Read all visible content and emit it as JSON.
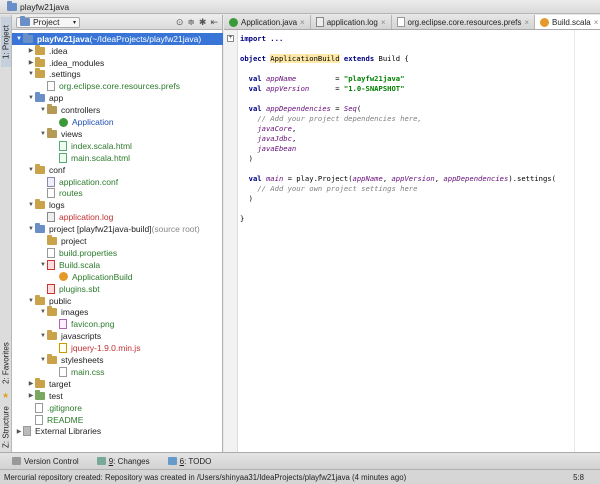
{
  "navbar": {
    "crumb": "playfw21java"
  },
  "left_tabs": {
    "project": "1: Project",
    "favorites": "2: Favorites",
    "structure": "Z: Structure"
  },
  "project_panel": {
    "selector": "Project"
  },
  "tree": [
    {
      "depth": 0,
      "arrow": "▼",
      "icon": "folder-blue",
      "label": "playfw21java",
      "extra": " (~/IdeaProjects/playfw21java)",
      "cls": "",
      "selected": true
    },
    {
      "depth": 1,
      "arrow": "▶",
      "icon": "folder",
      "label": ".idea",
      "cls": ""
    },
    {
      "depth": 1,
      "arrow": "▶",
      "icon": "folder",
      "label": ".idea_modules",
      "cls": ""
    },
    {
      "depth": 1,
      "arrow": "▼",
      "icon": "folder",
      "label": ".settings",
      "cls": ""
    },
    {
      "depth": 2,
      "arrow": "",
      "icon": "file",
      "label": "org.eclipse.core.resources.prefs",
      "cls": "t-green"
    },
    {
      "depth": 1,
      "arrow": "▼",
      "icon": "folder-blue",
      "label": "app",
      "cls": ""
    },
    {
      "depth": 2,
      "arrow": "▼",
      "icon": "folder-pkg",
      "label": "controllers",
      "cls": ""
    },
    {
      "depth": 3,
      "arrow": "",
      "icon": "class",
      "label": "Application",
      "cls": "t-blue"
    },
    {
      "depth": 2,
      "arrow": "▼",
      "icon": "folder-pkg",
      "label": "views",
      "cls": ""
    },
    {
      "depth": 3,
      "arrow": "",
      "icon": "html",
      "label": "index.scala.html",
      "cls": "t-green"
    },
    {
      "depth": 3,
      "arrow": "",
      "icon": "html",
      "label": "main.scala.html",
      "cls": "t-green"
    },
    {
      "depth": 1,
      "arrow": "▼",
      "icon": "folder",
      "label": "conf",
      "cls": ""
    },
    {
      "depth": 2,
      "arrow": "",
      "icon": "conf",
      "label": "application.conf",
      "cls": "t-green"
    },
    {
      "depth": 2,
      "arrow": "",
      "icon": "file",
      "label": "routes",
      "cls": "t-green"
    },
    {
      "depth": 1,
      "arrow": "▼",
      "icon": "folder",
      "label": "logs",
      "cls": ""
    },
    {
      "depth": 2,
      "arrow": "",
      "icon": "log",
      "label": "application.log",
      "cls": "t-red"
    },
    {
      "depth": 1,
      "arrow": "▼",
      "icon": "folder-blue",
      "label": "project [playfw21java-build]",
      "extra": " (source root)",
      "cls": ""
    },
    {
      "depth": 2,
      "arrow": "",
      "icon": "folder",
      "label": "project",
      "cls": ""
    },
    {
      "depth": 2,
      "arrow": "",
      "icon": "file",
      "label": "build.properties",
      "cls": "t-green"
    },
    {
      "depth": 2,
      "arrow": "▼",
      "icon": "scala",
      "label": "Build.scala",
      "cls": "t-green"
    },
    {
      "depth": 3,
      "arrow": "",
      "icon": "object",
      "label": "ApplicationBuild",
      "cls": "t-green"
    },
    {
      "depth": 2,
      "arrow": "",
      "icon": "scala",
      "label": "plugins.sbt",
      "cls": "t-green"
    },
    {
      "depth": 1,
      "arrow": "▼",
      "icon": "folder",
      "label": "public",
      "cls": ""
    },
    {
      "depth": 2,
      "arrow": "▼",
      "icon": "folder",
      "label": "images",
      "cls": ""
    },
    {
      "depth": 3,
      "arrow": "",
      "icon": "img",
      "label": "favicon.png",
      "cls": "t-green"
    },
    {
      "depth": 2,
      "arrow": "▼",
      "icon": "folder",
      "label": "javascripts",
      "cls": ""
    },
    {
      "depth": 3,
      "arrow": "",
      "icon": "js",
      "label": "jquery-1.9.0.min.js",
      "cls": "t-red"
    },
    {
      "depth": 2,
      "arrow": "▼",
      "icon": "folder",
      "label": "stylesheets",
      "cls": ""
    },
    {
      "depth": 3,
      "arrow": "",
      "icon": "file",
      "label": "main.css",
      "cls": "t-green"
    },
    {
      "depth": 1,
      "arrow": "▶",
      "icon": "folder",
      "label": "target",
      "cls": ""
    },
    {
      "depth": 1,
      "arrow": "▶",
      "icon": "folder-green",
      "label": "test",
      "cls": ""
    },
    {
      "depth": 1,
      "arrow": "",
      "icon": "file",
      "label": ".gitignore",
      "cls": "t-green"
    },
    {
      "depth": 1,
      "arrow": "",
      "icon": "file",
      "label": "README",
      "cls": "t-green"
    },
    {
      "depth": 0,
      "arrow": "▶",
      "icon": "lib",
      "label": "External Libraries",
      "cls": ""
    }
  ],
  "tabs": [
    {
      "label": "Application.java",
      "icon": "class",
      "active": false
    },
    {
      "label": "application.log",
      "icon": "log",
      "active": false
    },
    {
      "label": "org.eclipse.core.resources.prefs",
      "icon": "file",
      "active": false
    },
    {
      "label": "Build.scala",
      "icon": "object",
      "active": true
    }
  ],
  "code": {
    "import": "import ...",
    "obj_kw": "object ",
    "obj_name": "ApplicationBuild",
    "extends_kw": " extends ",
    "extends_name": "Build {",
    "val1": "appName",
    "val1_pad": "         = ",
    "str1": "\"playfw21java\"",
    "val2": "appVersion",
    "val2_pad": "      = ",
    "str2": "\"1.0-SNAPSHOT\"",
    "val3": "appDependencies",
    "val3_rest": " = ",
    "seq": "Seq",
    "seq_open": "(",
    "cmt1": "// Add your project dependencies here,",
    "dep1": "javaCore",
    "dep2": "javaJdbc",
    "dep3": "javaEbean",
    "close_paren": ")",
    "val4": "main",
    "main_rest1": " = play.Project(",
    "main_args_a": "appName",
    "main_args_b": "appVersion",
    "main_args_c": "appDependencies",
    "main_rest2": ").settings(",
    "cmt2": "// Add your own project settings here",
    "close_brace": "}"
  },
  "bottom_tools": {
    "vc": "Version Control",
    "changes_num": "9",
    "changes": ": Changes",
    "todo_num": "6",
    "todo": ": TODO"
  },
  "status": {
    "message": "Mercurial repository created: Repository was created in /Users/shinyaa31/IdeaProjects/playfw21java (4 minutes ago)",
    "position": "5:8"
  }
}
